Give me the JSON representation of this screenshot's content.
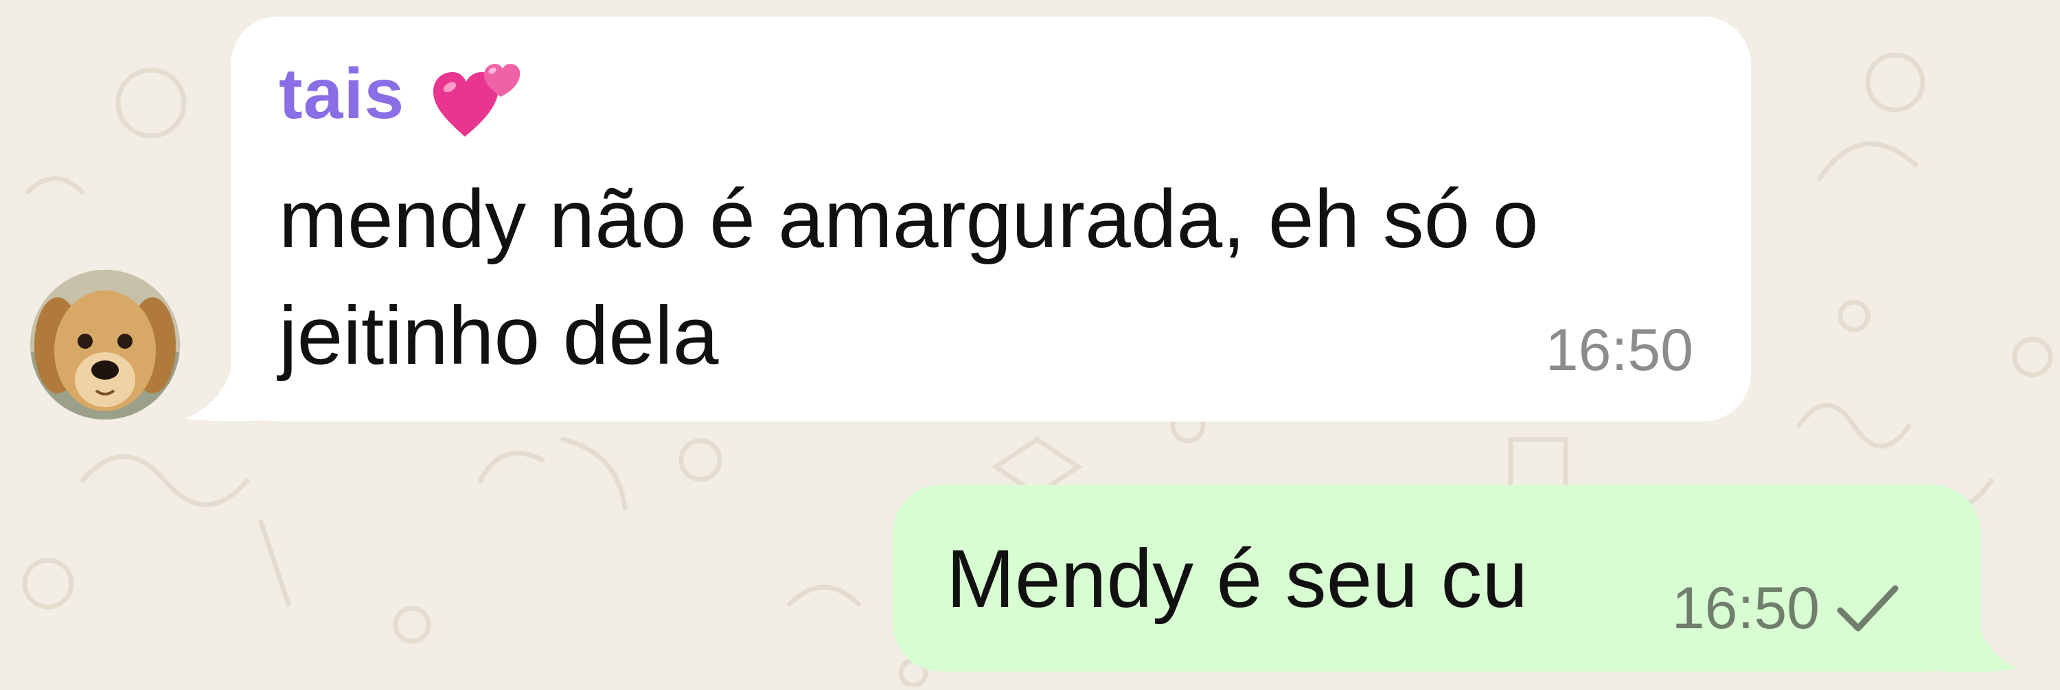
{
  "chat": {
    "incoming": {
      "sender_name": "tais",
      "sender_emoji": "two-hearts-icon",
      "text": "mendy não é amargurada, eh só o jeitinho dela",
      "time": "16:50"
    },
    "outgoing": {
      "text": "Mendy é seu cu",
      "time": "16:50",
      "status_icon": "single-check-icon"
    }
  },
  "colors": {
    "background": "#f2ede5",
    "incoming_bubble": "#ffffff",
    "outgoing_bubble": "#d8fdd2",
    "sender_name": "#8a6ee6",
    "timestamp": "#8c8c8c"
  }
}
